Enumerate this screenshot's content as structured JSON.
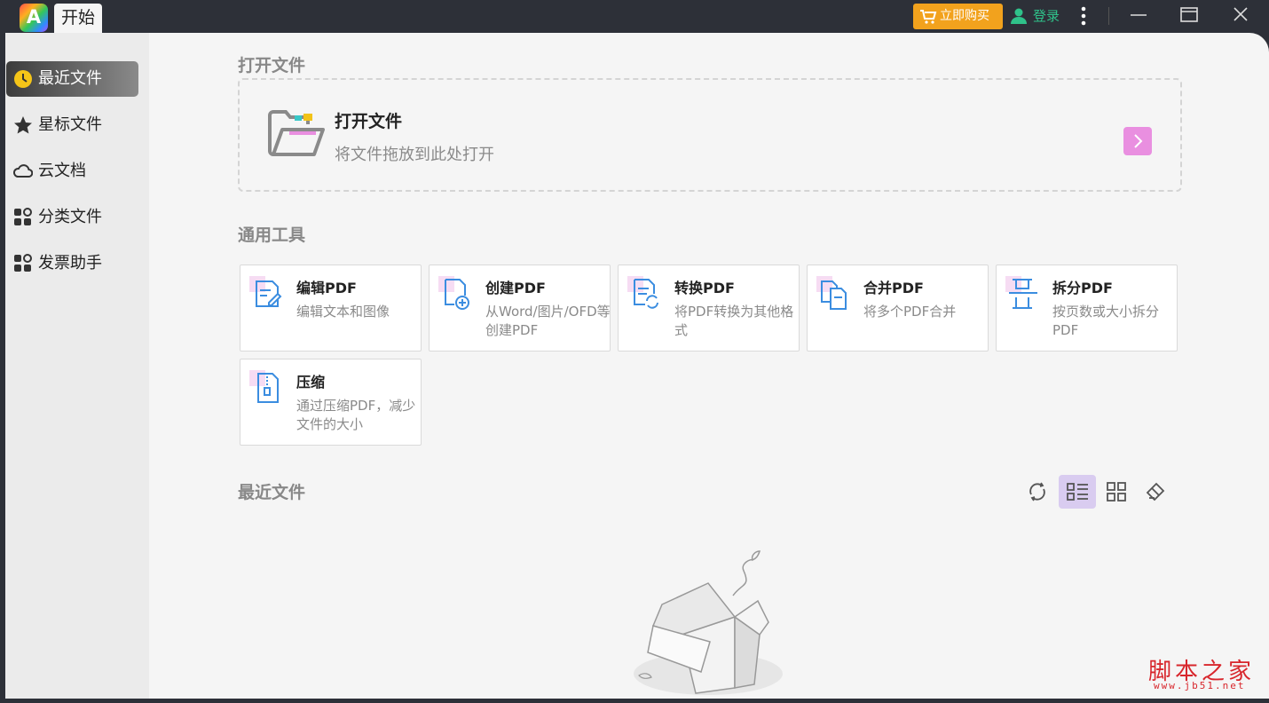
{
  "titlebar": {
    "logo_letter": "A",
    "tab_label": "开始",
    "buy_label": "立即购买",
    "login_label": "登录"
  },
  "sidebar": {
    "items": [
      {
        "label": "最近文件",
        "icon": "clock-icon",
        "active": true
      },
      {
        "label": "星标文件",
        "icon": "star-icon",
        "active": false
      },
      {
        "label": "云文档",
        "icon": "cloud-icon",
        "active": false
      },
      {
        "label": "分类文件",
        "icon": "category-icon",
        "active": false
      },
      {
        "label": "发票助手",
        "icon": "invoice-icon",
        "active": false
      }
    ]
  },
  "open_section": {
    "title": "打开文件",
    "drop_title": "打开文件",
    "drop_subtitle": "将文件拖放到此处打开"
  },
  "tools_section": {
    "title": "通用工具",
    "tools": [
      {
        "name": "编辑PDF",
        "desc": "编辑文本和图像",
        "icon": "edit-pdf-icon"
      },
      {
        "name": "创建PDF",
        "desc": "从Word/图片/OFD等创建PDF",
        "icon": "create-pdf-icon"
      },
      {
        "name": "转换PDF",
        "desc": "将PDF转换为其他格式",
        "icon": "convert-pdf-icon"
      },
      {
        "name": "合并PDF",
        "desc": "将多个PDF合并",
        "icon": "merge-pdf-icon"
      },
      {
        "name": "拆分PDF",
        "desc": "按页数或大小拆分PDF",
        "icon": "split-pdf-icon"
      },
      {
        "name": "压缩",
        "desc": "通过压缩PDF，减少文件的大小",
        "icon": "compress-icon"
      }
    ]
  },
  "recent_section": {
    "title": "最近文件",
    "view_buttons": [
      "refresh-icon",
      "list-view-icon",
      "grid-view-icon",
      "clear-icon"
    ],
    "active_view": "list-view-icon"
  },
  "watermark": {
    "text": "脚本之家",
    "url": "www.jb51.net"
  },
  "colors": {
    "accent_orange": "#f2a21d",
    "login_green": "#2fc28a",
    "arrow_pink": "#e98fe0",
    "active_view_bg": "#d9ccf0"
  }
}
